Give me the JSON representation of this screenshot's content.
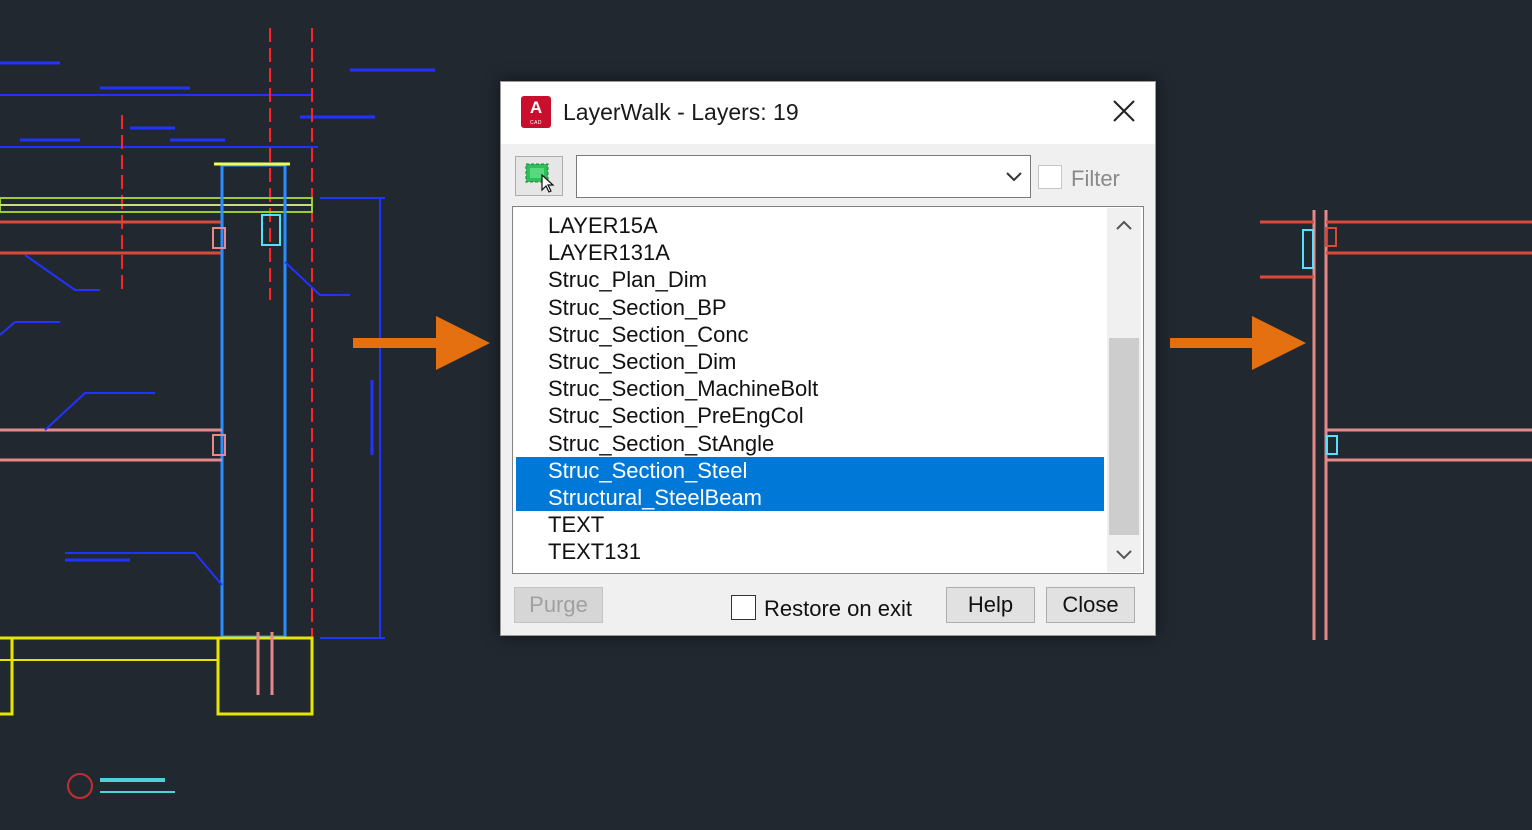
{
  "dialog": {
    "title": "LayerWalk - Layers: 19",
    "app_icon_letter": "A",
    "app_icon_sub": "CAD",
    "combo_value": "",
    "filter_label": "Filter",
    "filter_checked": false,
    "layers": [
      {
        "name": "LAYER15A",
        "selected": false
      },
      {
        "name": "LAYER131A",
        "selected": false
      },
      {
        "name": "Struc_Plan_Dim",
        "selected": false
      },
      {
        "name": "Struc_Section_BP",
        "selected": false
      },
      {
        "name": "Struc_Section_Conc",
        "selected": false
      },
      {
        "name": "Struc_Section_Dim",
        "selected": false
      },
      {
        "name": "Struc_Section_MachineBolt",
        "selected": false
      },
      {
        "name": "Struc_Section_PreEngCol",
        "selected": false
      },
      {
        "name": "Struc_Section_StAngle",
        "selected": false
      },
      {
        "name": "Struc_Section_Steel",
        "selected": true
      },
      {
        "name": "Structural_SteelBeam",
        "selected": true
      },
      {
        "name": "TEXT",
        "selected": false
      },
      {
        "name": "TEXT131",
        "selected": false
      }
    ],
    "purge_label": "Purge",
    "restore_label": "Restore on exit",
    "restore_checked": false,
    "help_label": "Help",
    "close_label": "Close"
  },
  "colors": {
    "background": "#212830",
    "selection": "#0078d7",
    "arrow": "#e5700f",
    "app_icon": "#c8102e"
  }
}
